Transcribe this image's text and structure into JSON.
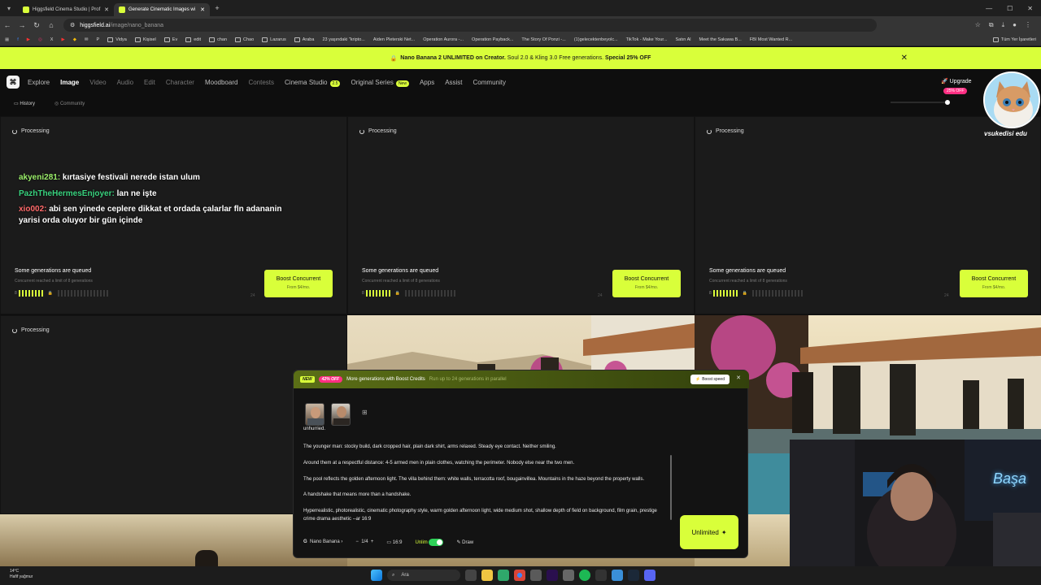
{
  "browser": {
    "tabs": [
      {
        "title": "Higgsfield Cinema Studio | Prof",
        "active": false
      },
      {
        "title": "Generate Cinematic Images wi",
        "active": true
      }
    ],
    "url_host": "higgsfield.ai",
    "url_path": "/image/nano_banana",
    "bookmarks": [
      "Vidya",
      "Kişisel",
      "Ev",
      "edit",
      "chan",
      "Chao",
      "Lazarus",
      "Araba",
      "23 yaşındaki \"kripto...",
      "Aiden Pleterski Net...",
      "Operation Aurora -...",
      "Operation Payback...",
      "The Story Of Ponzi -...",
      "(1)gelecektenbeyolc...",
      "TikTok - Make Your...",
      "Satın Al",
      "Meet the Sakawa B...",
      "FBI Most Wanted R..."
    ],
    "all_bookmarks": "Tüm Yer İşaretleri"
  },
  "promo": {
    "part1": "Nano Banana 2 UNLIMITED on Creator.",
    "part2": " Soul 2.0 & Kling 3.0 Free generations.",
    "part3": " Special 25% OFF"
  },
  "nav": {
    "items": [
      "Explore",
      "Image",
      "Video",
      "Audio",
      "Edit",
      "Character",
      "Moodboard",
      "Contests",
      "Cinema Studio",
      "Original Series",
      "Apps",
      "Assist",
      "Community"
    ],
    "cinema_badge": "2.5",
    "original_badge": "New",
    "upgrade": "Upgrade",
    "discount": "25% OFF"
  },
  "subnav": {
    "history": "History",
    "community": "Community"
  },
  "cards": {
    "processing": "Processing",
    "queued_title": "Some generations are queued",
    "queued_sub": "Concurrent reached a limit of 8 generations",
    "active_count": "8",
    "max_count": "24",
    "boost_label": "Boost Concurrent",
    "boost_sub": "From $4/mo."
  },
  "chat": [
    {
      "user": "akyeni281:",
      "color": "#9cf06b",
      "msg": " kırtasiye festivali nerede istan ulum"
    },
    {
      "user": "PazhTheHermesEnjoyer:",
      "color": "#39d37f",
      "msg": " lan ne işte"
    },
    {
      "user": "xio002:",
      "color": "#ff6a6a",
      "msg": " abi sen yinede ceplere dikkat et ordada çalarlar fln adananin yarisi orda oluyor bir gün içinde"
    }
  ],
  "composer": {
    "banner_new": "NEW",
    "banner_off": "42% OFF",
    "banner_title": "More generations with Boost Credits",
    "banner_sub": "Run up to 24 generations in parallel",
    "boost_speed": "Boost speed",
    "prompt_top": "unhurried.",
    "prompt_paragraphs": [
      "The younger man: stocky build, dark cropped hair, plain dark shirt, arms relaxed. Steady eye contact. Neither smiling.",
      "Around them at a respectful distance: 4-5 armed men in plain clothes, watching the perimeter. Nobody else near the two men.",
      "The pool reflects the golden afternoon light. The villa behind them: white walls, terracotta roof, bougainvillea. Mountains in the haze beyond the property walls.",
      "A handshake that means more than a handshake.",
      "Hyperrealistic, photorealistic, cinematic photography style, warm golden afternoon light, wide medium shot, shallow depth of field on background, film grain, prestige crime drama aesthetic --ar 16:9"
    ],
    "model": "Nano Banana",
    "count": "1/4",
    "ratio": "16:9",
    "unlim": "Unlim",
    "draw": "Draw",
    "generate": "Unlimited"
  },
  "overlay": {
    "cat_name": "vsukedisi edu",
    "neon": "Başa"
  },
  "taskbar": {
    "temp": "14°C",
    "weather": "Hafif yağmur",
    "search": "Ara"
  },
  "colors": {
    "accent": "#d9ff3a",
    "pink": "#ff2f83",
    "bg": "#0e0e0e",
    "card": "#1b1b1b"
  }
}
